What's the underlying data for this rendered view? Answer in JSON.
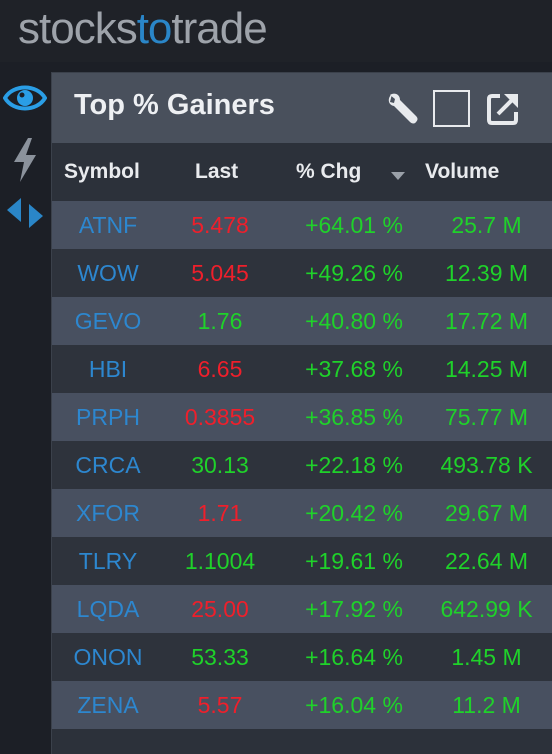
{
  "brand": {
    "part1": "stocks",
    "part2": "to",
    "part3": "trade"
  },
  "panel": {
    "title": "Top % Gainers",
    "columns": {
      "symbol": "Symbol",
      "last": "Last",
      "chg": "% Chg",
      "volume": "Volume"
    },
    "sort_indicator": "▼"
  },
  "rows": [
    {
      "symbol": "ATNF",
      "last": "5.478",
      "last_dir": "down",
      "chg": "+64.01 %",
      "volume": "25.7 M"
    },
    {
      "symbol": "WOW",
      "last": "5.045",
      "last_dir": "down",
      "chg": "+49.26 %",
      "volume": "12.39 M"
    },
    {
      "symbol": "GEVO",
      "last": "1.76",
      "last_dir": "up",
      "chg": "+40.80 %",
      "volume": "17.72 M"
    },
    {
      "symbol": "HBI",
      "last": "6.65",
      "last_dir": "down",
      "chg": "+37.68 %",
      "volume": "14.25 M"
    },
    {
      "symbol": "PRPH",
      "last": "0.3855",
      "last_dir": "down",
      "chg": "+36.85 %",
      "volume": "75.77 M"
    },
    {
      "symbol": "CRCA",
      "last": "30.13",
      "last_dir": "up",
      "chg": "+22.18 %",
      "volume": "493.78 K"
    },
    {
      "symbol": "XFOR",
      "last": "1.71",
      "last_dir": "down",
      "chg": "+20.42 %",
      "volume": "29.67 M"
    },
    {
      "symbol": "TLRY",
      "last": "1.1004",
      "last_dir": "up",
      "chg": "+19.61 %",
      "volume": "22.64 M"
    },
    {
      "symbol": "LQDA",
      "last": "25.00",
      "last_dir": "down",
      "chg": "+17.92 %",
      "volume": "642.99 K"
    },
    {
      "symbol": "ONON",
      "last": "53.33",
      "last_dir": "up",
      "chg": "+16.64 %",
      "volume": "1.45 M"
    },
    {
      "symbol": "ZENA",
      "last": "5.57",
      "last_dir": "down",
      "chg": "+16.04 %",
      "volume": "11.2 M"
    }
  ],
  "colors": {
    "accent": "#2a86c8",
    "up": "#1fd22a",
    "down": "#ef1f2b",
    "symbol": "#2d87cf"
  },
  "icons": {
    "rail": [
      "eye-icon",
      "lightning-icon",
      "arrows-icon"
    ],
    "header": [
      "wrench-icon",
      "checkbox-icon",
      "popout-icon"
    ]
  }
}
